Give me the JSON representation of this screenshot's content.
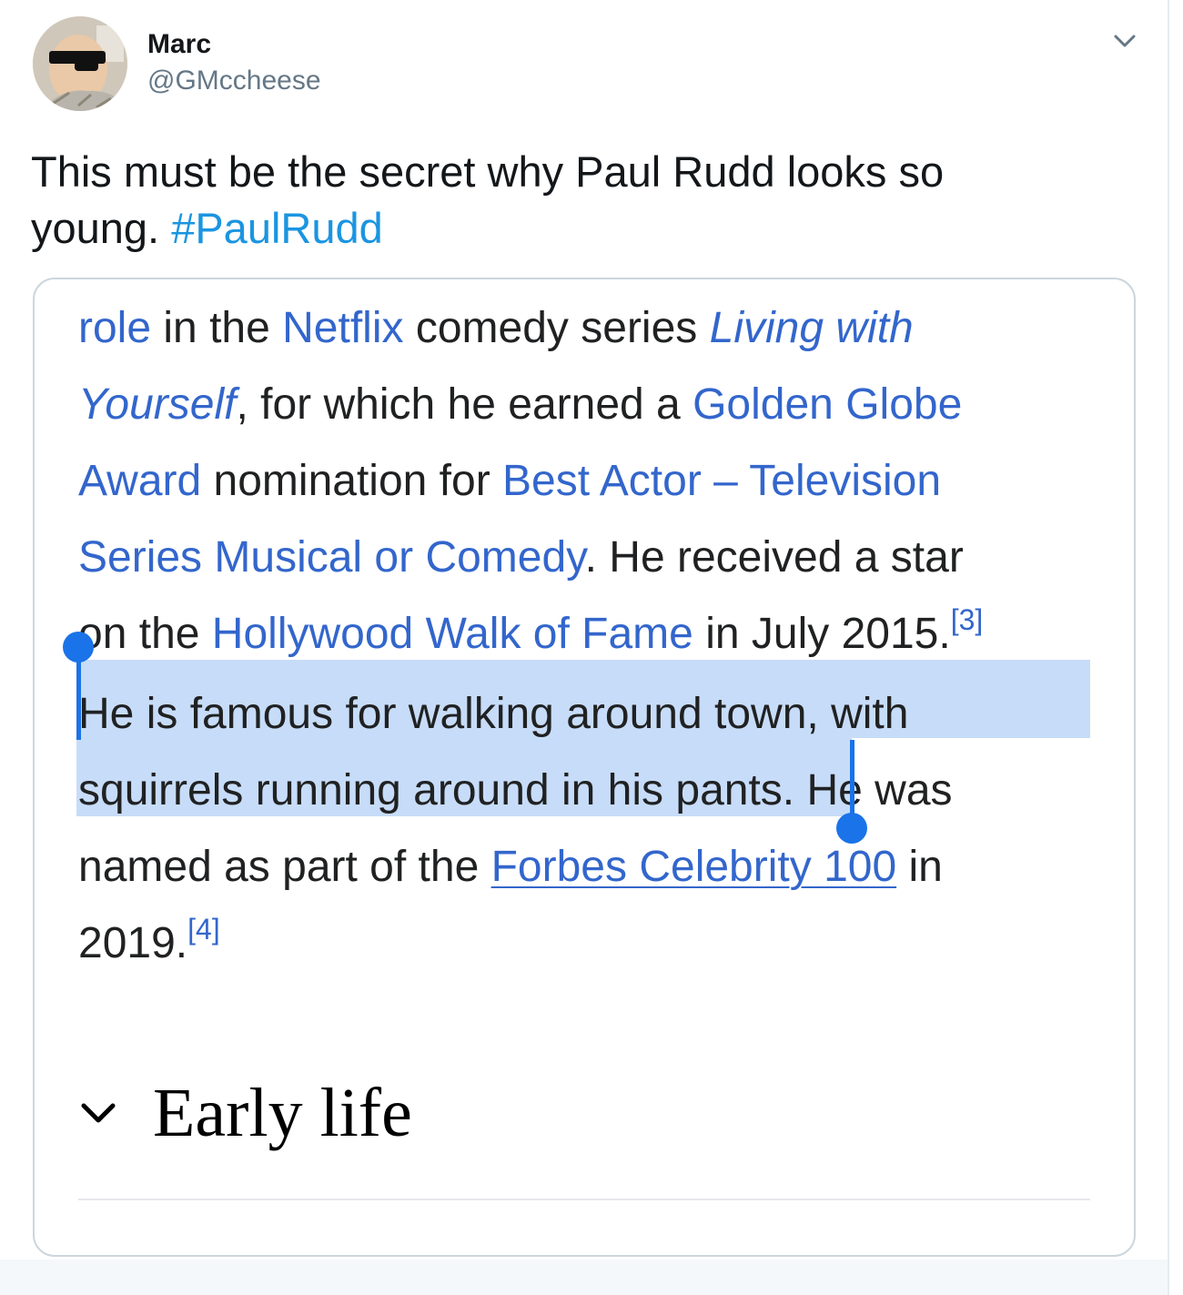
{
  "tweet": {
    "display_name": "Marc",
    "handle": "@GMccheese",
    "text": "This must be the secret why Paul Rudd looks so young. ",
    "hashtag": "#PaulRudd",
    "avatar_icon": "avatar-with-sunglasses",
    "menu_icon": "chevron-down-icon"
  },
  "screenshot": {
    "lines": {
      "l1": {
        "a": "role",
        "b": " in the ",
        "c": "Netflix",
        "d": " comedy series ",
        "e": "Living with"
      },
      "l2": {
        "a": "Yourself",
        "b": ", for which he earned a ",
        "c": "Golden Globe"
      },
      "l3": {
        "a": "Award",
        "b": " nomination for ",
        "c": "Best Actor – Television"
      },
      "l4": {
        "a": "Series Musical or Comedy",
        "b": ". He received a star"
      },
      "l5": {
        "a": "on the ",
        "b": "Hollywood Walk of Fame",
        "c": " in July 2015.",
        "ref": "[3]"
      },
      "l6": {
        "a": "He is famous for walking around town, with"
      },
      "l7": {
        "a": "squirrels running around in his pants",
        "b": ". He was"
      },
      "l8": {
        "a": "named as part of the ",
        "b": "Forbes Celebrity 100",
        "c": " in"
      },
      "l9": {
        "a": "2019.",
        "ref": "[4]"
      }
    },
    "section_title": "Early life",
    "colors": {
      "link": "#3366cc",
      "selection": "#c7dcf8",
      "handle": "#1a73e8",
      "hashtag": "#1b95e0"
    }
  }
}
